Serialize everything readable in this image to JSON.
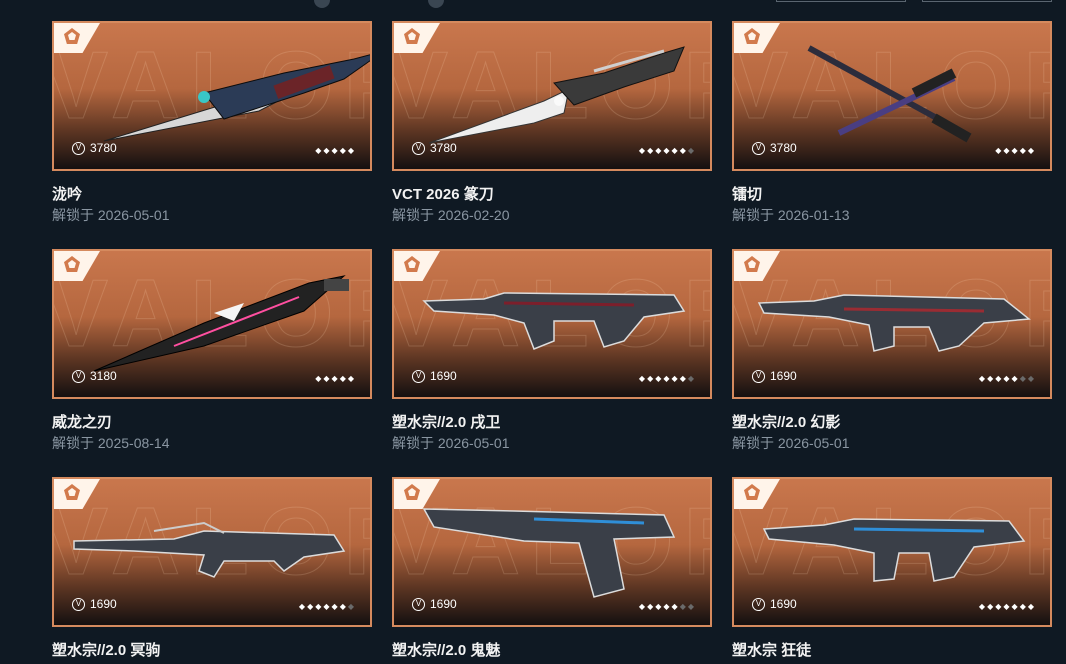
{
  "price_icon": "vp-currency-icon",
  "rating_icon": "diamond-icon",
  "unlock_prefix": "解锁于",
  "items": [
    {
      "name": "泷吟",
      "date": "2026-05-01",
      "price": "3780",
      "rating": 5,
      "rating_max": 5
    },
    {
      "name": "VCT 2026 篆刀",
      "date": "2026-02-20",
      "price": "3780",
      "rating": 6,
      "rating_max": 7
    },
    {
      "name": "镭切",
      "date": "2026-01-13",
      "price": "3780",
      "rating": 5,
      "rating_max": 5
    },
    {
      "name": "威龙之刃",
      "date": "2025-08-14",
      "price": "3180",
      "rating": 5,
      "rating_max": 5
    },
    {
      "name": "塑水宗//2.0 戌卫",
      "date": "2026-05-01",
      "price": "1690",
      "rating": 6,
      "rating_max": 7
    },
    {
      "name": "塑水宗//2.0 幻影",
      "date": "2026-05-01",
      "price": "1690",
      "rating": 5,
      "rating_max": 7
    },
    {
      "name": "塑水宗//2.0 冥驹",
      "date": "",
      "price": "1690",
      "rating": 6,
      "rating_max": 7
    },
    {
      "name": "塑水宗//2.0 鬼魅",
      "date": "",
      "price": "1690",
      "rating": 5,
      "rating_max": 7
    },
    {
      "name": "塑水宗 狂徒",
      "date": "",
      "price": "1690",
      "rating": 7,
      "rating_max": 7
    }
  ],
  "colors": {
    "background": "#0f1923",
    "card_border": "#d58a5e",
    "card_top": "#c9774d",
    "text_muted": "#8a96a2"
  }
}
